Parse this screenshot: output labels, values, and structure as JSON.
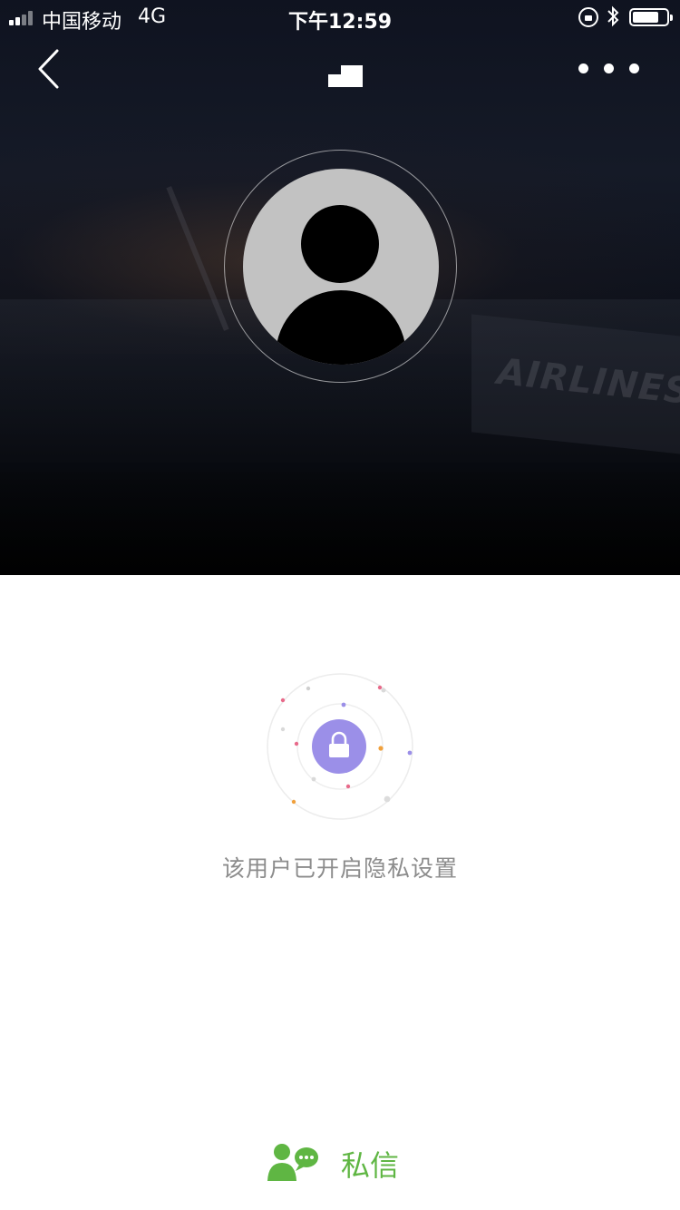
{
  "status_bar": {
    "carrier": "中国移动",
    "network": "4G",
    "time": "下午12:59",
    "signal_bars": 2,
    "battery_level": 0.7
  },
  "nav": {
    "back_icon": "chevron-left-icon",
    "more_icon": "more-dots-icon"
  },
  "hero": {
    "background_text": "AIRLINES"
  },
  "profile": {
    "avatar_icon": "default-avatar-icon"
  },
  "privacy": {
    "icon": "lock-icon",
    "message": "该用户已开启隐私设置",
    "accent_color": "#9b8fe8"
  },
  "actions": {
    "message_label": "私信",
    "message_icon": "user-chat-icon",
    "accent_color": "#5fb643"
  }
}
